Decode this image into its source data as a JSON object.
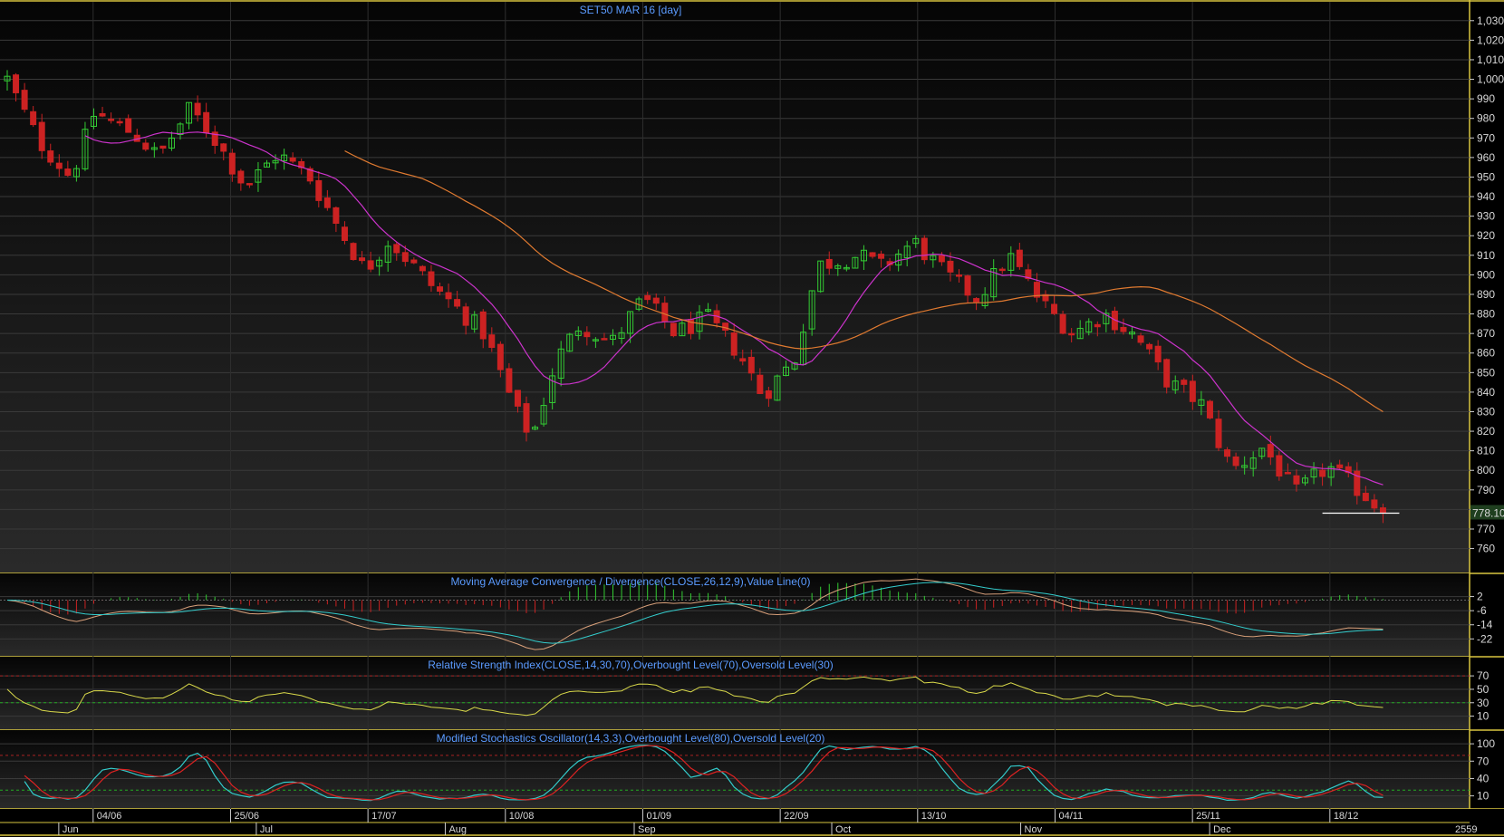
{
  "colors": {
    "border": "#d9c640",
    "up": "#33cc33",
    "down": "#cc2222",
    "ma_short": "#cc33cc",
    "ma_long": "#e07a30",
    "macd_line": "#33cccc",
    "macd_signal": "#d9a07a",
    "rsi": "#d9d94a",
    "stoch_k": "#33cccc",
    "stoch_d": "#dd2222",
    "title": "#5b9bff",
    "last_label_bg": "#1f3f1f",
    "last_label_text": "#ffffff"
  },
  "chart_data": [
    {
      "type": "candlestick",
      "title": "SET50 MAR 16   [day]",
      "ylim": [
        751,
        1035
      ],
      "yticks": [
        760,
        770,
        780,
        790,
        800,
        810,
        820,
        830,
        840,
        850,
        860,
        870,
        880,
        890,
        900,
        910,
        920,
        930,
        940,
        950,
        960,
        970,
        980,
        990,
        1000,
        1010,
        1020,
        1030
      ],
      "ytick_labels": [
        "760",
        "770",
        "780",
        "790",
        "800",
        "810",
        "820",
        "830",
        "840",
        "850",
        "860",
        "870",
        "880",
        "890",
        "900",
        "910",
        "920",
        "930",
        "940",
        "950",
        "960",
        "970",
        "980",
        "990",
        "1,000",
        "1,010",
        "1,020",
        "1,030"
      ],
      "last_value_label": "778.10",
      "bars": 160,
      "series_hint": "daily OHLC, June–December 2015"
    },
    {
      "type": "line",
      "title": "Moving Average Convergence / Divergence(CLOSE,26,12,9),Value Line(0)",
      "ylim": [
        -28,
        10
      ],
      "yticks": [
        2,
        -6,
        -14,
        -22
      ],
      "ytick_labels": [
        "2",
        "-6",
        "-14",
        "-22"
      ]
    },
    {
      "type": "line",
      "title": "Relative Strength Index(CLOSE,14,30,70),Overbought Level(70),Oversold Level(30)",
      "ylim": [
        0,
        85
      ],
      "yticks": [
        70,
        50,
        30,
        10
      ],
      "ytick_labels": [
        "70",
        "50",
        "30",
        "10"
      ]
    },
    {
      "type": "line",
      "title": "Modified Stochastics Oscillator(14,3,3),Overbought Level(80),Oversold Level(20)",
      "ylim": [
        0,
        108
      ],
      "yticks": [
        100,
        70,
        40,
        10
      ],
      "ytick_labels": [
        "100",
        "70",
        "40",
        "10"
      ]
    }
  ],
  "x_axis": {
    "date_labels": [
      {
        "bar": 10,
        "text": "04/06"
      },
      {
        "bar": 26,
        "text": "25/06"
      },
      {
        "bar": 42,
        "text": "17/07"
      },
      {
        "bar": 58,
        "text": "10/08"
      },
      {
        "bar": 74,
        "text": "01/09"
      },
      {
        "bar": 90,
        "text": "22/09"
      },
      {
        "bar": 106,
        "text": "13/10"
      },
      {
        "bar": 122,
        "text": "04/11"
      },
      {
        "bar": 138,
        "text": "25/11"
      },
      {
        "bar": 154,
        "text": "18/12"
      }
    ],
    "month_labels": [
      {
        "bar": 6,
        "text": "Jun"
      },
      {
        "bar": 29,
        "text": "Jul"
      },
      {
        "bar": 51,
        "text": "Aug"
      },
      {
        "bar": 73,
        "text": "Sep"
      },
      {
        "bar": 96,
        "text": "Oct"
      },
      {
        "bar": 118,
        "text": "Nov"
      },
      {
        "bar": 140,
        "text": "Dec"
      }
    ],
    "year_label": "2559"
  }
}
